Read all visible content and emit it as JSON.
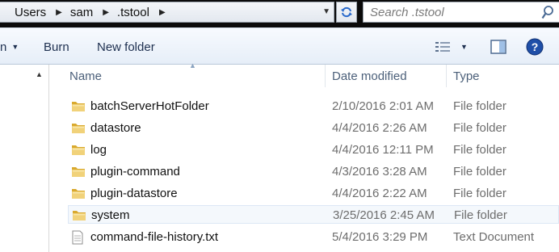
{
  "address": {
    "crumbs": [
      "Users",
      "sam",
      ".tstool"
    ],
    "separator": "▶",
    "dropdown_glyph": "▼"
  },
  "search": {
    "placeholder": "Search .tstool"
  },
  "toolbar": {
    "open_partial": "n",
    "open_caret": "▼",
    "burn_label": "Burn",
    "new_folder_label": "New folder",
    "views_caret": "▼"
  },
  "nav": {
    "scroll_up_glyph": "▲"
  },
  "columns": {
    "name": "Name",
    "date_modified": "Date modified",
    "type": "Type",
    "sort_glyph": "▲"
  },
  "files": [
    {
      "name": "batchServerHotFolder",
      "date": "2/10/2016 2:01 AM",
      "type": "File folder",
      "icon": "folder-icon"
    },
    {
      "name": "datastore",
      "date": "4/4/2016 2:26 AM",
      "type": "File folder",
      "icon": "folder-icon"
    },
    {
      "name": "log",
      "date": "4/4/2016 12:11 PM",
      "type": "File folder",
      "icon": "folder-icon"
    },
    {
      "name": "plugin-command",
      "date": "4/3/2016 3:28 AM",
      "type": "File folder",
      "icon": "folder-icon"
    },
    {
      "name": "plugin-datastore",
      "date": "4/4/2016 2:22 AM",
      "type": "File folder",
      "icon": "folder-icon"
    },
    {
      "name": "system",
      "date": "3/25/2016 2:45 AM",
      "type": "File folder",
      "icon": "folder-icon",
      "selected": true
    },
    {
      "name": "command-file-history.txt",
      "date": "5/4/2016 3:29 PM",
      "type": "Text Document",
      "icon": "text-file-icon"
    }
  ],
  "colors": {
    "toolbar_text": "#1e3050",
    "header_text": "#4c607a",
    "detail_text": "#6d6d6d",
    "folder_yellow": "#e8c35a",
    "help_blue": "#1f4fa8"
  }
}
